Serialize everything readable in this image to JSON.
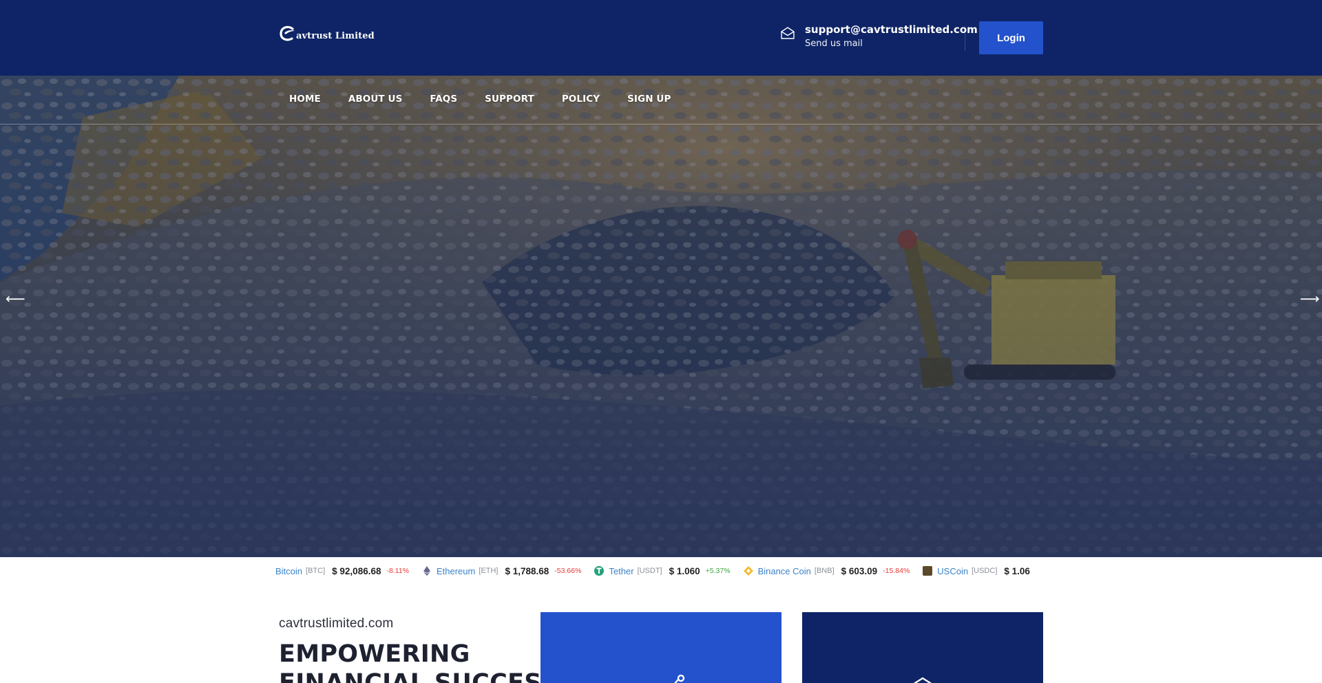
{
  "header": {
    "brand": "avtrust Limited",
    "contact_email": "support@cavtrustlimited.com",
    "contact_sub": "Send us mail",
    "login_label": "Login"
  },
  "nav": {
    "items": [
      {
        "label": "HOME"
      },
      {
        "label": "ABOUT US"
      },
      {
        "label": "FAQS"
      },
      {
        "label": "SUPPORT"
      },
      {
        "label": "POLICY"
      },
      {
        "label": "SIGN UP"
      }
    ]
  },
  "slider": {
    "prev_label": "⟵",
    "next_label": "⟶"
  },
  "ticker": {
    "coins": [
      {
        "name": "Bitcoin",
        "symbol": "[BTC]",
        "price": "$ 92,086.68",
        "change": "-8.11%",
        "direction": "neg",
        "icon": "bitcoin-icon",
        "color": "#f7931a"
      },
      {
        "name": "Ethereum",
        "symbol": "[ETH]",
        "price": "$ 1,788.68",
        "change": "-53.66%",
        "direction": "neg",
        "icon": "ethereum-icon",
        "color": "#62688f"
      },
      {
        "name": "Tether",
        "symbol": "[USDT]",
        "price": "$ 1.060",
        "change": "+5.37%",
        "direction": "pos",
        "icon": "tether-icon",
        "color": "#26a17b"
      },
      {
        "name": "Binance Coin",
        "symbol": "[BNB]",
        "price": "$ 603.09",
        "change": "-15.84%",
        "direction": "neg",
        "icon": "binance-icon",
        "color": "#f3ba2f"
      },
      {
        "name": "USCoin",
        "symbol": "[USDC]",
        "price": "$ 1.06",
        "change": "",
        "direction": "pos",
        "icon": "usdc-icon",
        "color": "#5a4a2a"
      }
    ]
  },
  "content": {
    "domain": "cavtrustlimited.com",
    "headline_line1": "EMPOWERING",
    "headline_line2": "FINANCIAL SUCCESS"
  },
  "colors": {
    "navy": "#0e2466",
    "accent_blue": "#2452cc",
    "ticker_name": "#3a83c8",
    "negative": "#e53935",
    "positive": "#3aa540"
  }
}
